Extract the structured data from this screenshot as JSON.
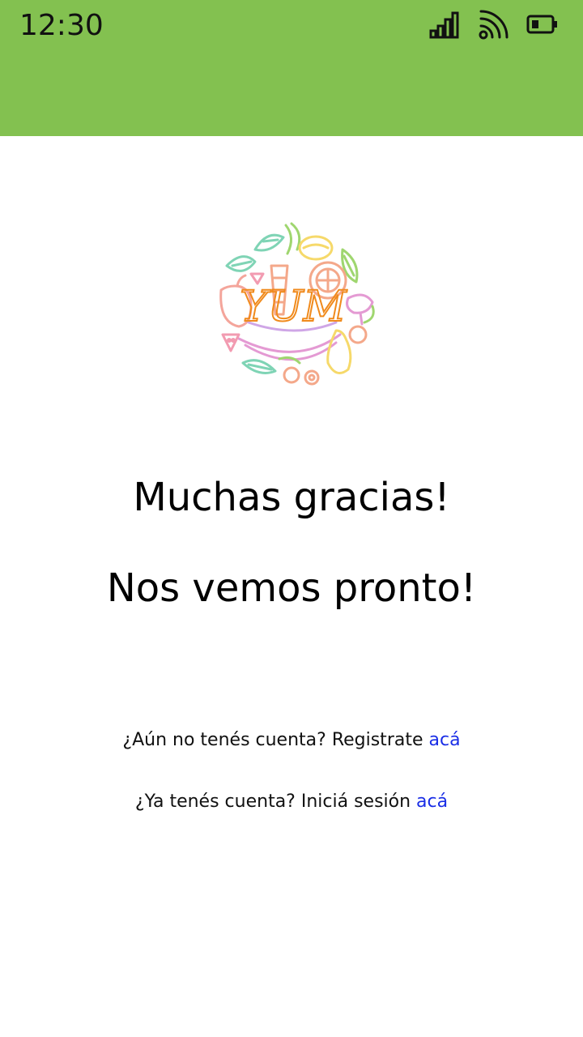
{
  "status_bar": {
    "time": "12:30",
    "icons": [
      "signal-icon",
      "wifi-icon",
      "battery-icon"
    ]
  },
  "colors": {
    "app_bar": "#83c150",
    "link": "#1a2ee6",
    "logo_text": "#f08a1c"
  },
  "logo": {
    "text": "YUM"
  },
  "main": {
    "thanks": "Muchas gracias!",
    "see_you": "Nos vemos pronto!"
  },
  "register": {
    "prompt": "¿Aún no tenés cuenta? Registrate",
    "link": "acá"
  },
  "login": {
    "prompt": "¿Ya tenés cuenta? Iniciá sesión",
    "link": "acá"
  }
}
